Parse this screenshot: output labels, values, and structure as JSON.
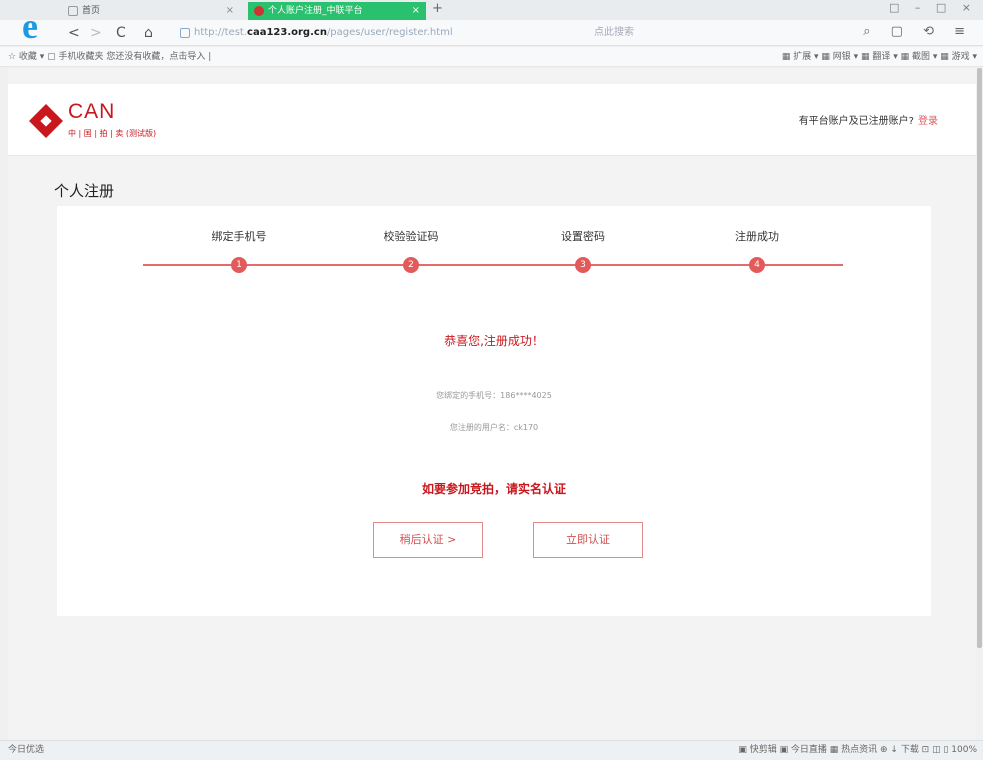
{
  "browser": {
    "tabs": [
      {
        "label": "首页"
      },
      {
        "label": "个人账户注册_中联平台"
      }
    ],
    "new_tab": "+",
    "window_controls": "□ – □ ×",
    "nav": {
      "back": "<",
      "forward": ">",
      "reload": "C",
      "home": "⌂"
    },
    "url_prefix": "http://test.",
    "url_domain": "caa123.org.cn",
    "url_path": "/pages/user/register.html",
    "search_placeholder": "点此搜索",
    "toolbar_right": "⌕ ▢ ⟲ ≡",
    "bookmarks_left": "☆ 收藏 ▾  ▢ 手机收藏夹  您还没有收藏，点击导入 |",
    "bookmarks_right": "▦ 扩展 ▾  ▦ 网银 ▾  ▦ 翻译 ▾  ▦ 截图 ▾  ▦ 游戏 ▾"
  },
  "header": {
    "logo_text": "CAN",
    "logo_sub": "中 | 国 | 拍 | 卖 (测试版)",
    "login_prompt": "有平台账户及已注册账户?",
    "login_link": "登录"
  },
  "page_title": "个人注册",
  "steps": [
    {
      "num": "1",
      "label": "绑定手机号"
    },
    {
      "num": "2",
      "label": "校验验证码"
    },
    {
      "num": "3",
      "label": "设置密码"
    },
    {
      "num": "4",
      "label": "注册成功"
    }
  ],
  "result": {
    "success": "恭喜您,注册成功！",
    "phone_line": "您绑定的手机号：186****4025",
    "user_line": "您注册的用户名：ck170",
    "notice": "如要参加竞拍，请实名认证",
    "later_button": "稍后认证 >",
    "now_button": "立即认证"
  },
  "status": {
    "left": "今日优选",
    "right": "▣ 快剪辑  ▣ 今日直播  ▦ 热点资讯  ⊕  ↓ 下载  ⊡  ◫  ▯  100%"
  },
  "colors": {
    "brand_red": "#c8171d",
    "step_red": "#e35a5a",
    "tab_green": "#29c16d"
  }
}
